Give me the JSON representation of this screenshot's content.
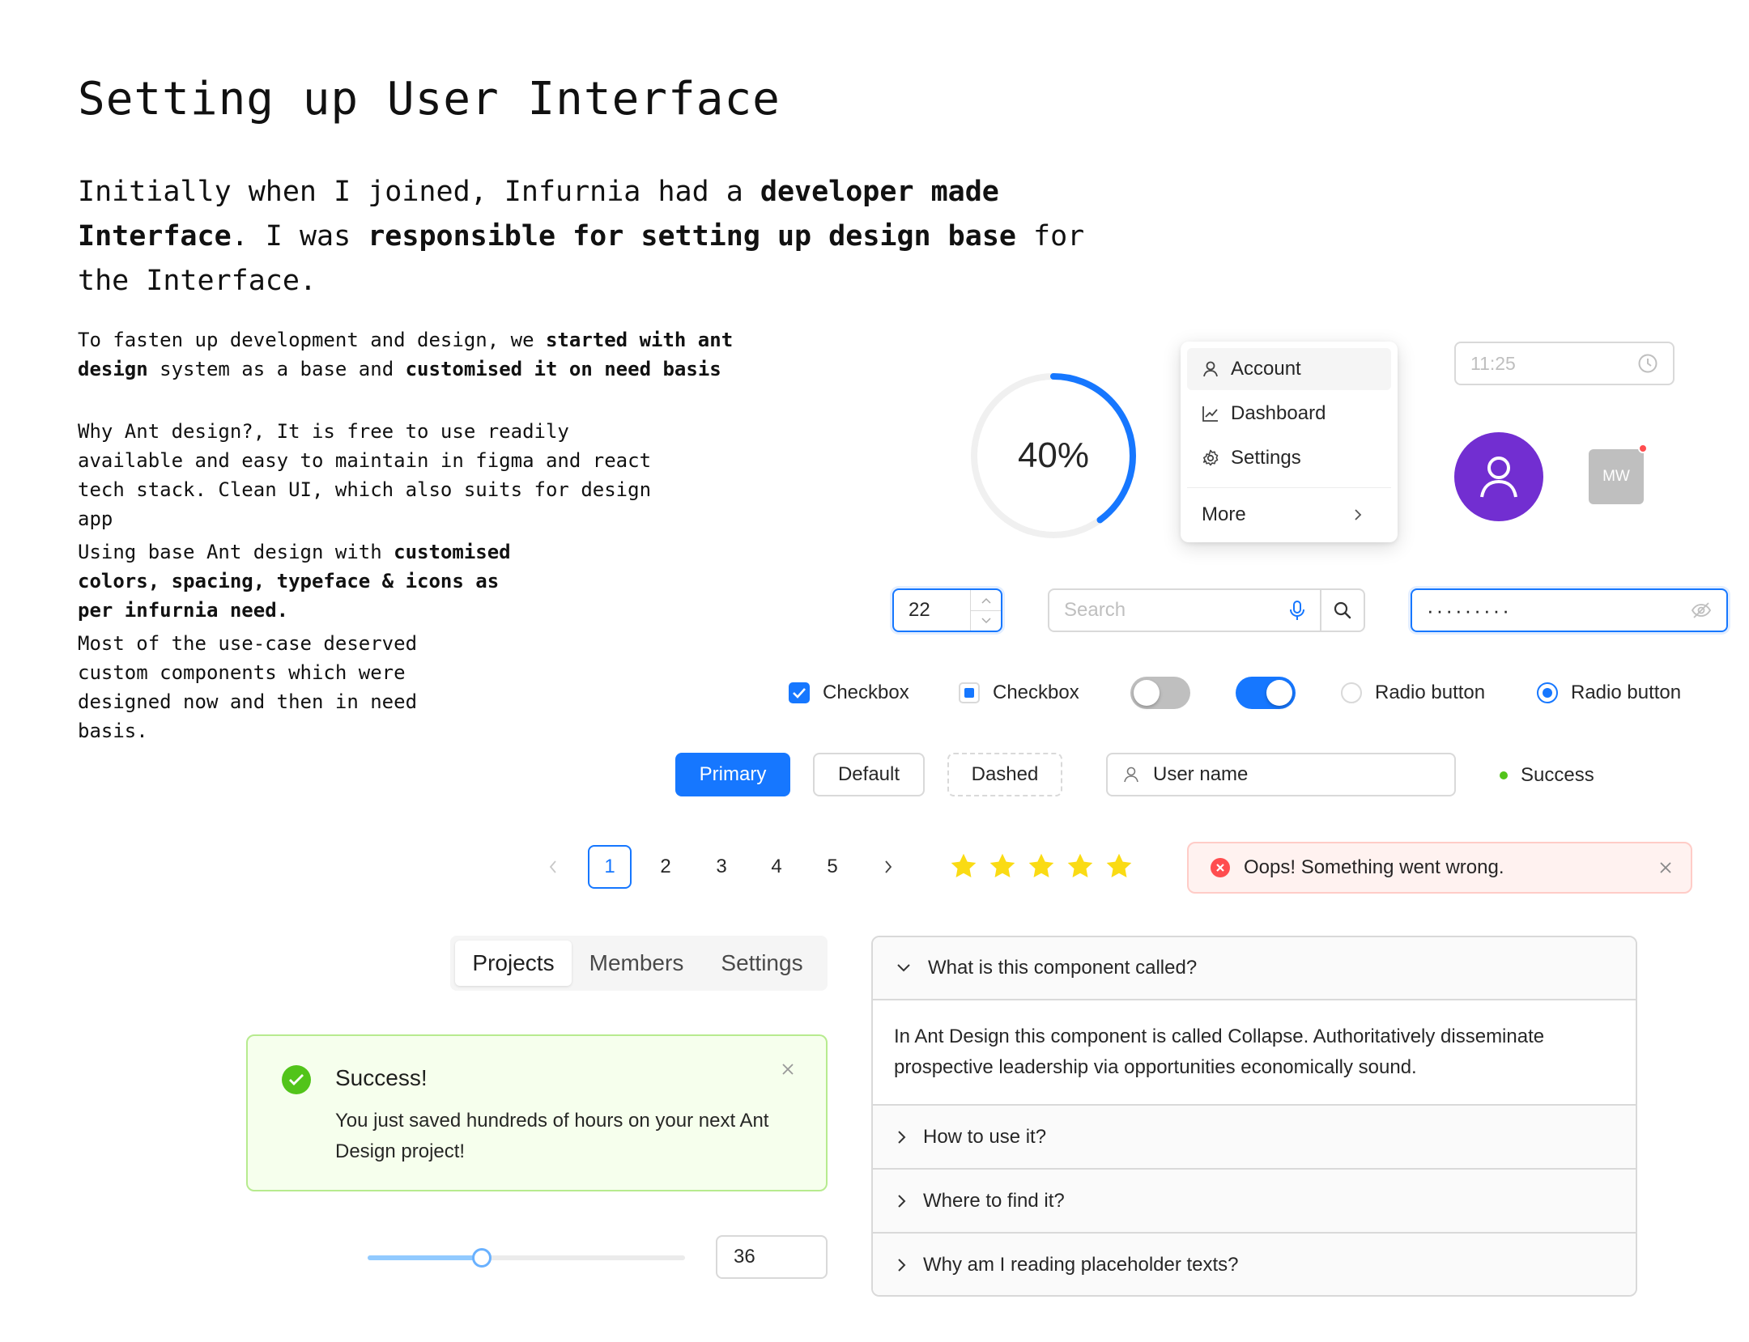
{
  "heading": {
    "title": "Setting up User Interface",
    "intro_part1": "Initially when I joined, Infurnia had a ",
    "intro_bold1": "developer made Interface",
    "intro_part2": ". I was ",
    "intro_bold2": "responsible for setting up design base",
    "intro_part3": " for the Interface."
  },
  "paragraphs": {
    "p1_a": "To fasten up development and design, we ",
    "p1_b": "started with ant design",
    "p1_c": " system as a base and ",
    "p1_d": "customised it on need basis",
    "p2": "Why Ant design?, It is free to use readily available and easy to maintain in figma and react tech stack. Clean UI, which also suits for design app",
    "p3_a": "Using base Ant design with ",
    "p3_b": "customised colors, spacing, typeface & icons as per infurnia need.",
    "p4": "Most of the use-case deserved custom components which were designed now and then in need basis."
  },
  "progress": {
    "label": "40%",
    "percent": 40,
    "color": "#1677ff"
  },
  "dropdown": {
    "items": [
      {
        "label": "Account",
        "icon": "user-icon"
      },
      {
        "label": "Dashboard",
        "icon": "chart-line-icon"
      },
      {
        "label": "Settings",
        "icon": "gear-icon"
      }
    ],
    "more_label": "More"
  },
  "time_picker": {
    "placeholder": "11:25",
    "icon": "clock-icon"
  },
  "avatars": {
    "initials": "MW",
    "icon_avatar_color": "#722ed1"
  },
  "number_input": {
    "value": "22"
  },
  "search": {
    "placeholder": "Search"
  },
  "password": {
    "value": "·········"
  },
  "selection": {
    "checkbox1": {
      "label": "Checkbox",
      "checked": true
    },
    "checkbox2": {
      "label": "Checkbox",
      "indeterminate": true
    },
    "switch1": {
      "on": false
    },
    "switch2": {
      "on": true
    },
    "radio1": {
      "label": "Radio button",
      "checked": false
    },
    "radio2": {
      "label": "Radio button",
      "checked": true
    }
  },
  "buttons": {
    "primary": "Primary",
    "default": "Default",
    "dashed": "Dashed"
  },
  "username": {
    "placeholder": "User name"
  },
  "status": {
    "label": "Success",
    "color": "#52c41a"
  },
  "pagination": {
    "pages": [
      "1",
      "2",
      "3",
      "4",
      "5"
    ],
    "current": "1"
  },
  "rating": {
    "value": 5,
    "max": 5,
    "color": "#fadb14"
  },
  "error_alert": {
    "message": "Oops! Something went wrong."
  },
  "segmented": {
    "options": [
      "Projects",
      "Members",
      "Settings"
    ],
    "selected": "Projects"
  },
  "success_alert": {
    "title": "Success!",
    "description": "You just saved hundreds of hours on your next Ant Design project!"
  },
  "slider": {
    "value": 36,
    "min": 0,
    "max": 100,
    "input_value": "36"
  },
  "collapse": {
    "panels": [
      {
        "header": "What is this component called?",
        "expanded": true,
        "content": "In Ant Design this component is called Collapse. Authoritatively disseminate prospective leadership via opportunities economically sound."
      },
      {
        "header": "How to use it?",
        "expanded": false
      },
      {
        "header": "Where to find it?",
        "expanded": false
      },
      {
        "header": "Why am I reading placeholder texts?",
        "expanded": false
      }
    ]
  },
  "colors": {
    "primary": "#1677ff",
    "success": "#52c41a",
    "error": "#ff4d4f",
    "purple": "#722ed1"
  }
}
